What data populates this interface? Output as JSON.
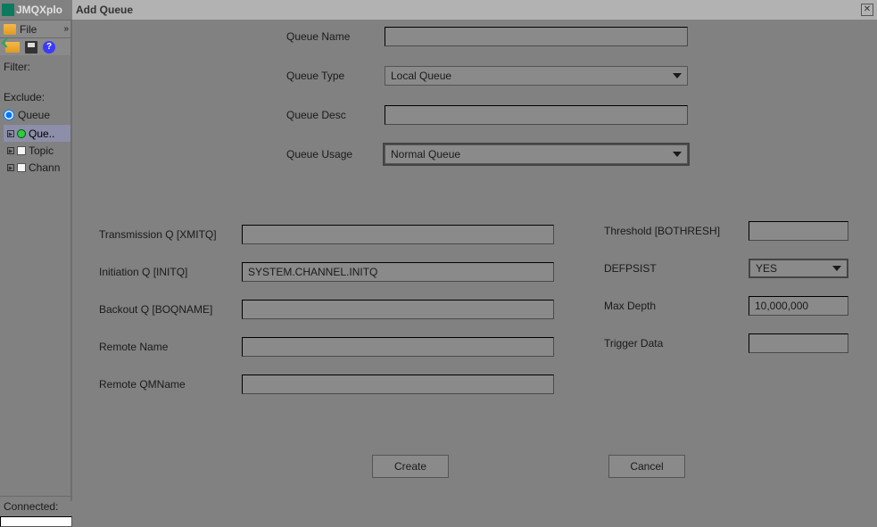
{
  "app": {
    "title": "JMQXplo"
  },
  "menu": {
    "file": "File"
  },
  "sidebar": {
    "filter_label": "Filter:",
    "exclude_label": "Exclude:",
    "radio_label": "Queue",
    "tree": [
      {
        "label": "Que..",
        "selected": true,
        "icon": "dot"
      },
      {
        "label": "Topic",
        "selected": false,
        "icon": "square"
      },
      {
        "label": "Chann",
        "selected": false,
        "icon": "square"
      }
    ],
    "status": "Connected:"
  },
  "dialog": {
    "title": "Add Queue",
    "top": {
      "queue_name": {
        "label": "Queue Name",
        "value": ""
      },
      "queue_type": {
        "label": "Queue Type",
        "value": "Local Queue"
      },
      "queue_desc": {
        "label": "Queue Desc",
        "value": ""
      },
      "queue_usage": {
        "label": "Queue Usage",
        "value": "Normal Queue"
      }
    },
    "left": {
      "xmitq": {
        "label": "Transmission Q [XMITQ]",
        "value": ""
      },
      "initq": {
        "label": "Initiation Q [INITQ]",
        "value": "SYSTEM.CHANNEL.INITQ"
      },
      "boqname": {
        "label": "Backout Q [BOQNAME]",
        "value": ""
      },
      "remote_name": {
        "label": "Remote Name",
        "value": ""
      },
      "remote_qmname": {
        "label": "Remote QMName",
        "value": ""
      }
    },
    "right": {
      "bothresh": {
        "label": "Threshold [BOTHRESH]",
        "value": ""
      },
      "defpsist": {
        "label": "DEFPSIST",
        "value": "YES"
      },
      "max_depth": {
        "label": "Max Depth",
        "value": "10,000,000"
      },
      "trigger_data": {
        "label": "Trigger Data",
        "value": ""
      }
    },
    "buttons": {
      "create": "Create",
      "cancel": "Cancel"
    }
  }
}
